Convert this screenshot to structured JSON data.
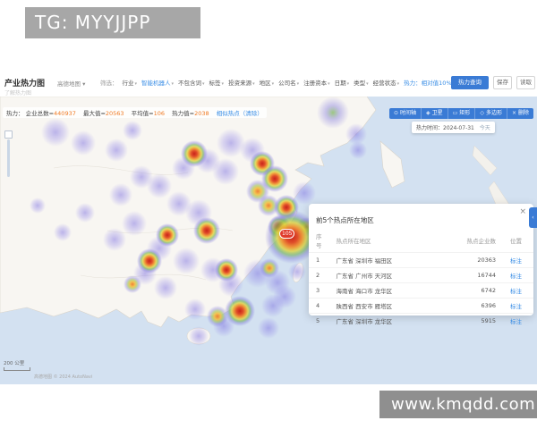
{
  "watermark_top": "TG: MYYJJPP",
  "watermark_bottom": "www.kmqdd.com",
  "header": {
    "title": "产业热力图",
    "map_source": "高德地图",
    "caret": "▾",
    "help_link": "了解热力图",
    "filter_label": "筛选：",
    "filters": [
      {
        "label": "行业"
      },
      {
        "label": "智能机器人"
      },
      {
        "label": "不包含词"
      },
      {
        "label": "标签"
      },
      {
        "label": "投资来源"
      },
      {
        "label": "地区"
      },
      {
        "label": "公司名"
      },
      {
        "label": "注册资本"
      },
      {
        "label": "日期"
      },
      {
        "label": "类型"
      },
      {
        "label": "经营状态"
      },
      {
        "label": "热力：相对值10%"
      }
    ],
    "query_button": "热力查询",
    "save_button": "保存",
    "load_button": "读取"
  },
  "map": {
    "stats_label": "热力：",
    "stats": [
      {
        "label": "企业总数=",
        "value": "440937"
      },
      {
        "label": "最大值=",
        "value": "20563"
      },
      {
        "label": "平均值=",
        "value": "106"
      },
      {
        "label": "热力值=",
        "value": "2038"
      }
    ],
    "similar_link": "相似热点",
    "clear_link": "（清除）",
    "toolbar": [
      {
        "icon": "⊙",
        "label": "时间轴"
      },
      {
        "icon": "◈",
        "label": "卫星"
      },
      {
        "icon": "▭",
        "label": "矩形"
      },
      {
        "icon": "◇",
        "label": "多边形"
      },
      {
        "icon": "×",
        "label": "删除"
      }
    ],
    "time_label": "热力时间：2024-07-31",
    "today_link": "今天",
    "cluster_badge": "105",
    "scale_label": "200 公里",
    "attribution": "高德地图 © 2024 AutoNavi"
  },
  "panel": {
    "title": "前5个热点所在地区",
    "close": "×",
    "collapse": "‹",
    "columns": [
      "序号",
      "热点所在地区",
      "热点企业数",
      "位置"
    ],
    "rows": [
      {
        "no": "1",
        "area": "广东省 深圳市 福田区",
        "count": "20363",
        "action": "标注"
      },
      {
        "no": "2",
        "area": "广东省 广州市 天河区",
        "count": "16744",
        "action": "标注"
      },
      {
        "no": "3",
        "area": "海南省 海口市 龙华区",
        "count": "6742",
        "action": "标注"
      },
      {
        "no": "4",
        "area": "陕西省 西安市 雁塔区",
        "count": "6396",
        "action": "标注"
      },
      {
        "no": "5",
        "area": "广东省 深圳市 龙华区",
        "count": "5915",
        "action": "标注"
      }
    ]
  },
  "colors": {
    "accent": "#3a7bd5",
    "link": "#3a8ee6",
    "heat_core": "#d93025",
    "sea": "#d3e1f1"
  }
}
